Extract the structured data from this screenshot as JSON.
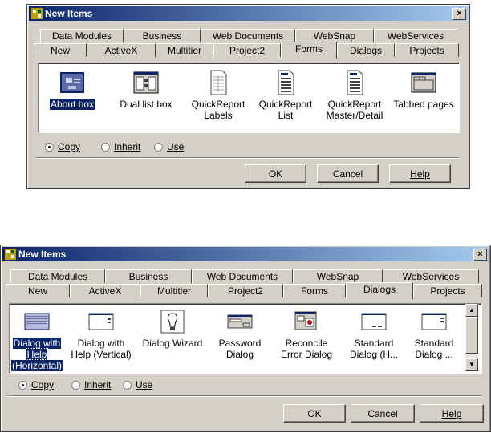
{
  "dialog1": {
    "title": "New Items",
    "close": "×",
    "tabs_back": [
      "Data Modules",
      "Business",
      "Web Documents",
      "WebSnap",
      "WebServices"
    ],
    "tabs_front": [
      "New",
      "ActiveX",
      "Multitier",
      "Project2",
      "Forms",
      "Dialogs",
      "Projects"
    ],
    "active_tab": "Forms",
    "items": [
      {
        "label1": "About box",
        "label2": "",
        "icon": "form-about-icon"
      },
      {
        "label1": "Dual list box",
        "label2": "",
        "icon": "dual-list-icon"
      },
      {
        "label1": "QuickReport",
        "label2": "Labels",
        "icon": "report-labels-icon"
      },
      {
        "label1": "QuickReport",
        "label2": "List",
        "icon": "report-list-icon"
      },
      {
        "label1": "QuickReport",
        "label2": "Master/Detail",
        "icon": "report-master-icon"
      },
      {
        "label1": "Tabbed pages",
        "label2": "",
        "icon": "tabbed-pages-icon"
      }
    ],
    "radio": {
      "copy": "Copy",
      "inherit": "Inherit",
      "use": "Use",
      "selected": "Copy"
    },
    "buttons": {
      "ok": "OK",
      "cancel": "Cancel",
      "help": "Help"
    }
  },
  "dialog2": {
    "title": "New Items",
    "close": "×",
    "tabs_back": [
      "Data Modules",
      "Business",
      "Web Documents",
      "WebSnap",
      "WebServices"
    ],
    "tabs_front": [
      "New",
      "ActiveX",
      "Multitier",
      "Project2",
      "Forms",
      "Dialogs",
      "Projects"
    ],
    "active_tab": "Dialogs",
    "items": [
      {
        "label1": "Dialog with",
        "label2": "Help",
        "label3": "(Horizontal)",
        "icon": "dialog-help-horizontal-icon"
      },
      {
        "label1": "Dialog with",
        "label2": "Help (Vertical)",
        "label3": "",
        "icon": "dialog-help-vertical-icon"
      },
      {
        "label1": "Dialog Wizard",
        "label2": "",
        "label3": "",
        "icon": "dialog-wizard-icon"
      },
      {
        "label1": "Password",
        "label2": "Dialog",
        "label3": "",
        "icon": "password-dialog-icon"
      },
      {
        "label1": "Reconcile",
        "label2": "Error Dialog",
        "label3": "",
        "icon": "reconcile-error-icon"
      },
      {
        "label1": "Standard",
        "label2": "Dialog (H...",
        "label3": "",
        "icon": "standard-dialog-h-icon"
      },
      {
        "label1": "Standard",
        "label2": "Dialog ...",
        "label3": "",
        "icon": "standard-dialog-icon"
      }
    ],
    "radio": {
      "copy": "Copy",
      "inherit": "Inherit",
      "use": "Use",
      "selected": "Copy"
    },
    "buttons": {
      "ok": "OK",
      "cancel": "Cancel",
      "help": "Help"
    }
  }
}
